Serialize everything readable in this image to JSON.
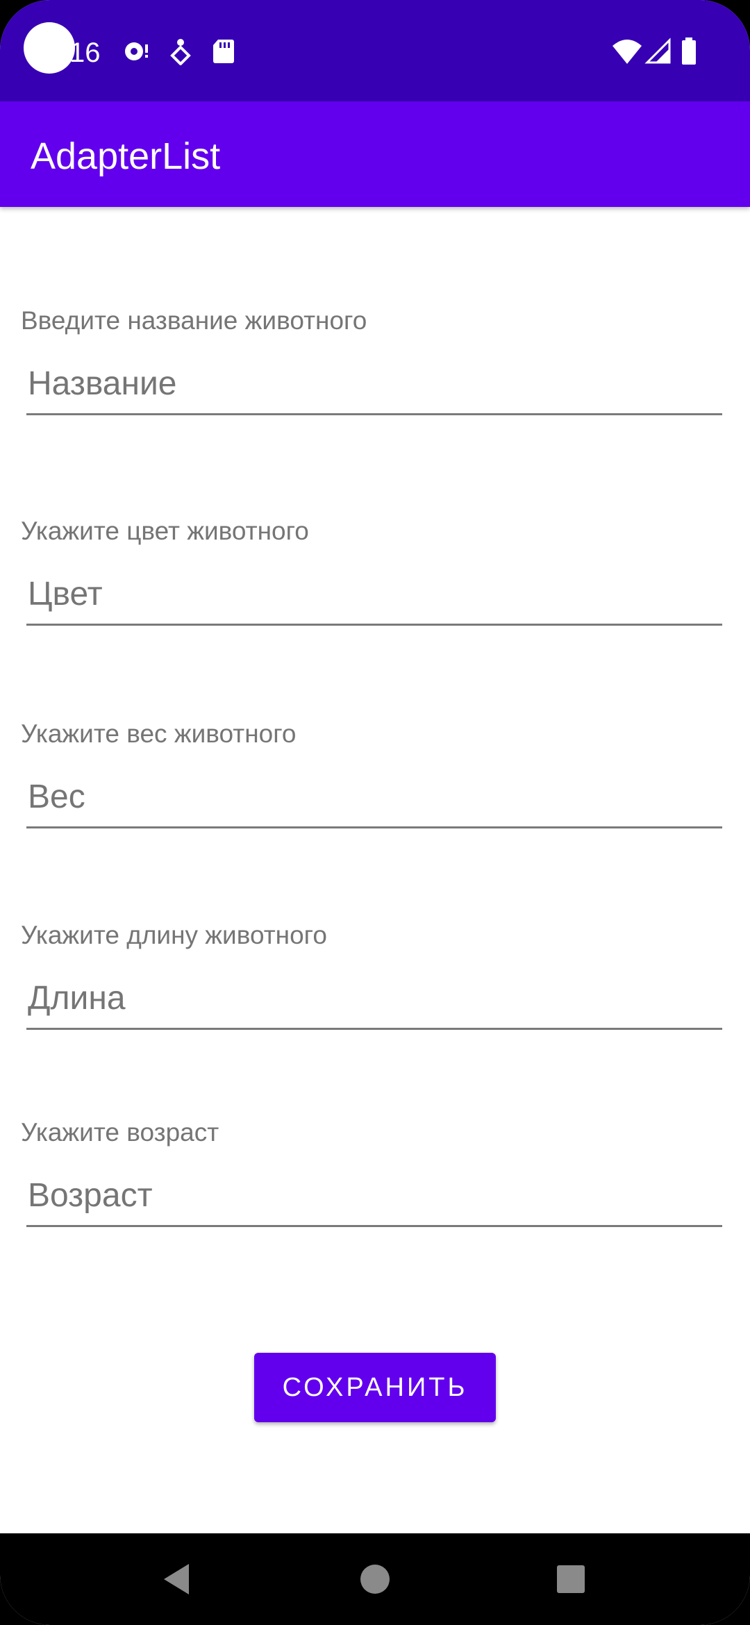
{
  "status_bar": {
    "time": "16",
    "icons": [
      "camera-punch-hole",
      "podcast-icon",
      "accessibility-icon",
      "sd-card-icon",
      "wifi-icon",
      "signal-icon",
      "battery-icon"
    ]
  },
  "app_bar": {
    "title": "AdapterList"
  },
  "form": {
    "name_label": "Введите название животного",
    "name_value": "Название",
    "color_label": "Укажите цвет животного",
    "color_placeholder": "Цвет",
    "weight_label": "Укажите вес животного",
    "weight_placeholder": "Вес",
    "length_label": "Укажите длину животного",
    "length_value": "Длина",
    "age_label": "Укажите возраст",
    "age_value": "Возраст",
    "save_label": "СОХРАНИТЬ"
  },
  "nav_bar": {
    "icons": [
      "back-icon",
      "home-icon",
      "recents-icon"
    ]
  },
  "colors": {
    "status_bar": "#3700b3",
    "app_bar": "#6200ee",
    "accent": "#6200ee"
  }
}
